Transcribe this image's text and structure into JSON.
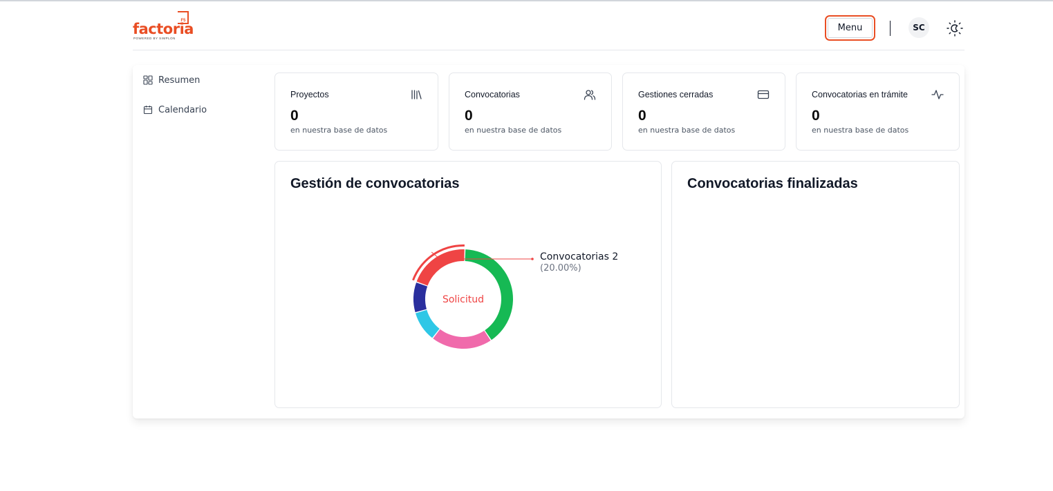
{
  "header": {
    "logo": {
      "word": "factoria",
      "tagline": "POWERED BY SIMPLON",
      "mark": "F5"
    },
    "menu_label": "Menu",
    "avatar_initials": "SC",
    "theme_icon": "sun-moon-icon"
  },
  "sidebar": {
    "items": [
      {
        "label": "Resumen",
        "icon": "grid-icon"
      },
      {
        "label": "Calendario",
        "icon": "calendar-icon"
      }
    ]
  },
  "stats": [
    {
      "title": "Proyectos",
      "value": "0",
      "subtitle": "en nuestra base de datos",
      "icon": "library-icon"
    },
    {
      "title": "Convocatorias",
      "value": "0",
      "subtitle": "en nuestra base de datos",
      "icon": "users-icon"
    },
    {
      "title": "Gestiones cerradas",
      "value": "0",
      "subtitle": "en nuestra base de datos",
      "icon": "credit-card-icon"
    },
    {
      "title": "Convocatorias en trámite",
      "value": "0",
      "subtitle": "en nuestra base de datos",
      "icon": "activity-icon"
    }
  ],
  "charts": {
    "gestion": {
      "title": "Gestión de convocatorias",
      "center_label": "Solicitud",
      "tooltip_name": "Convocatorias 2",
      "tooltip_pct": "(20.00%)"
    },
    "finalizadas": {
      "title": "Convocatorias finalizadas"
    }
  },
  "chart_data": {
    "type": "pie",
    "variant": "donut",
    "series": [
      {
        "value": 10,
        "color": "#2a2f9e"
      },
      {
        "value": 20,
        "color": "#ef4444",
        "active": true
      },
      {
        "value": 40,
        "color": "#16b954"
      },
      {
        "value": 20,
        "color": "#f06aab"
      },
      {
        "value": 10,
        "color": "#2ec7e6"
      }
    ],
    "center_label": "Solicitud",
    "highlight_label": "Convocatorias 2",
    "highlight_pct": "20.00%"
  },
  "colors": {
    "brand": "#e94e24",
    "border": "#e5e7eb",
    "text": "#111827"
  }
}
